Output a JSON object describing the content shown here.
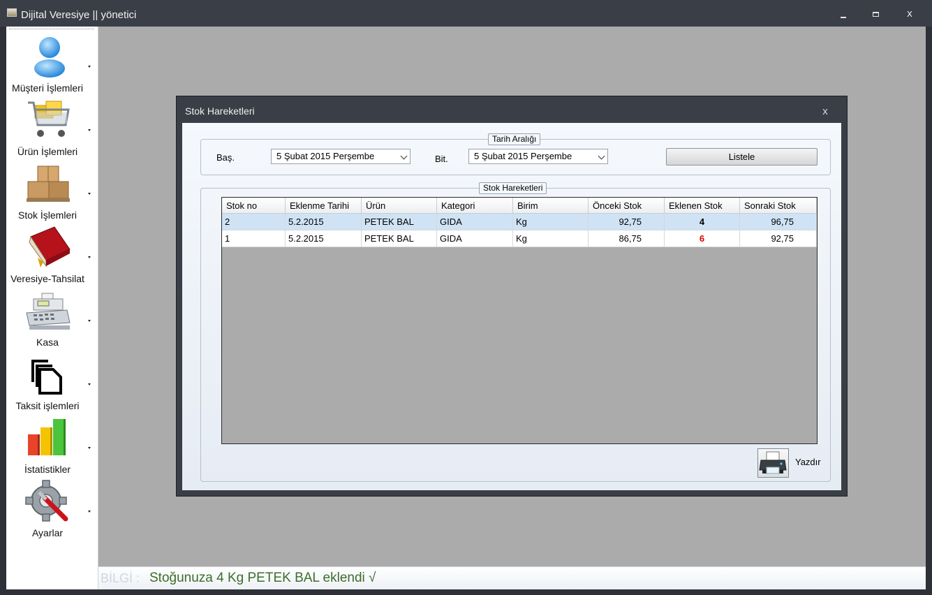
{
  "window": {
    "title": "Dijital Veresiye  ||  yönetici",
    "minimize_icon": "minimize-icon",
    "maximize_icon": "maximize-icon",
    "close_glyph": "x"
  },
  "sidebar": {
    "items": [
      {
        "label": "Müşteri İşlemleri",
        "icon": "user-icon"
      },
      {
        "label": "Ürün İşlemleri",
        "icon": "shopping-cart-icon"
      },
      {
        "label": "Stok İşlemleri",
        "icon": "boxes-icon"
      },
      {
        "label": "Veresiye-Tahsilat",
        "icon": "ledger-book-icon"
      },
      {
        "label": "Kasa",
        "icon": "cash-register-icon"
      },
      {
        "label": "Taksit işlemleri",
        "icon": "documents-icon"
      },
      {
        "label": "İstatistikler",
        "icon": "bar-chart-icon"
      },
      {
        "label": "Ayarlar",
        "icon": "settings-gear-icon"
      }
    ]
  },
  "dialog": {
    "title": "Stok Hareketleri",
    "close_glyph": "x",
    "date_group": {
      "title": "Tarih Aralığı",
      "start_label": "Baş.",
      "start_value": "5   Şubat   2015 Perşembe",
      "end_label": "Bit.",
      "end_value": "5   Şubat   2015 Perşembe",
      "list_button": "Listele"
    },
    "movements_group": {
      "title": "Stok Hareketleri",
      "columns": [
        "Stok no",
        "Eklenme Tarihi",
        "Ürün",
        "Kategori",
        "Birim",
        "Önceki Stok",
        "Eklenen Stok",
        "Sonraki Stok"
      ],
      "rows": [
        [
          "2",
          "5.2.2015",
          "PETEK BAL",
          "GIDA",
          "Kg",
          "92,75",
          "4",
          "96,75"
        ],
        [
          "1",
          "5.2.2015",
          "PETEK BAL",
          "GIDA",
          "Kg",
          "86,75",
          "6",
          "92,75"
        ]
      ],
      "added_colors": [
        "#000000",
        "#e00000"
      ],
      "print_icon": "printer-icon",
      "print_label": "Yazdır"
    }
  },
  "status": {
    "prefix": "BİLGİ  :",
    "message": "Stoğunuza 4 Kg PETEK BAL eklendi  √"
  },
  "colors": {
    "chrome": "#3a3e47",
    "mdi_background": "#ababab",
    "selected_row": "#cfe3f5",
    "status_text": "#3b6e2a"
  }
}
